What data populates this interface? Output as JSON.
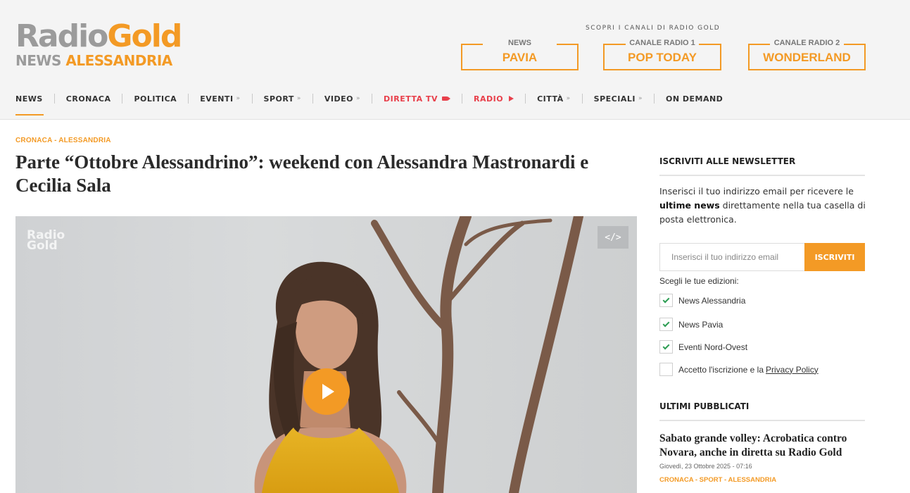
{
  "header": {
    "logo": {
      "radio": "Radio",
      "gold": "Gold",
      "news": "NEWS",
      "city": "ALESSANDRIA"
    },
    "discover_label": "SCOPRI I CANALI DI RADIO GOLD",
    "channels": [
      {
        "top": "NEWS",
        "name": "PAVIA"
      },
      {
        "top": "CANALE RADIO 1",
        "name": "POP TODAY"
      },
      {
        "top": "CANALE RADIO 2",
        "name": "WONDERLAND"
      }
    ]
  },
  "nav": {
    "items": [
      {
        "label": "NEWS"
      },
      {
        "label": "CRONACA"
      },
      {
        "label": "POLITICA"
      },
      {
        "label": "EVENTI",
        "chevron": "»"
      },
      {
        "label": "SPORT",
        "chevron": "»"
      },
      {
        "label": "VIDEO",
        "chevron": "»"
      },
      {
        "label": "DIRETTA TV"
      },
      {
        "label": "RADIO"
      },
      {
        "label": "CITTÀ",
        "chevron": "»"
      },
      {
        "label": "SPECIALI",
        "chevron": "»"
      },
      {
        "label": "ON DEMAND"
      }
    ]
  },
  "article": {
    "kicker": "CRONACA - ALESSANDRIA",
    "title": "Parte “Ottobre Alessandrino”: weekend con Alessandra Mastronardi e Cecilia Sala",
    "video": {
      "watermark_line1": "Radio",
      "watermark_line2": "Gold",
      "embed_label": "</>"
    }
  },
  "sidebar": {
    "newsletter": {
      "heading": "ISCRIVITI ALLE NEWSLETTER",
      "desc_before": "Inserisci il tuo indirizzo email per ricevere le ",
      "desc_bold": "ultime news",
      "desc_after": " direttamente nella tua casella di posta elettronica.",
      "email_placeholder": "Inserisci il tuo indirizzo email",
      "subscribe_label": "ISCRIVITI",
      "editions_label": "Scegli le tue edizioni:",
      "editions": [
        {
          "label": "News Alessandria",
          "checked": true
        },
        {
          "label": "News Pavia",
          "checked": true
        },
        {
          "label": "Eventi Nord-Ovest",
          "checked": true
        }
      ],
      "privacy_text": "Accetto l'iscrizione e la",
      "privacy_link": "Privacy Policy"
    },
    "latest": {
      "heading": "ULTIMI PUBBLICATI",
      "title": "Sabato grande volley: Acrobatica contro Novara, anche in diretta su Radio Gold",
      "date": "Giovedì, 23 Ottobre 2025 - 07:16",
      "categories": "CRONACA - SPORT - ALESSANDRIA"
    }
  },
  "colors": {
    "accent": "#f39a25",
    "red": "#e8404b",
    "check": "#2e9e54"
  }
}
